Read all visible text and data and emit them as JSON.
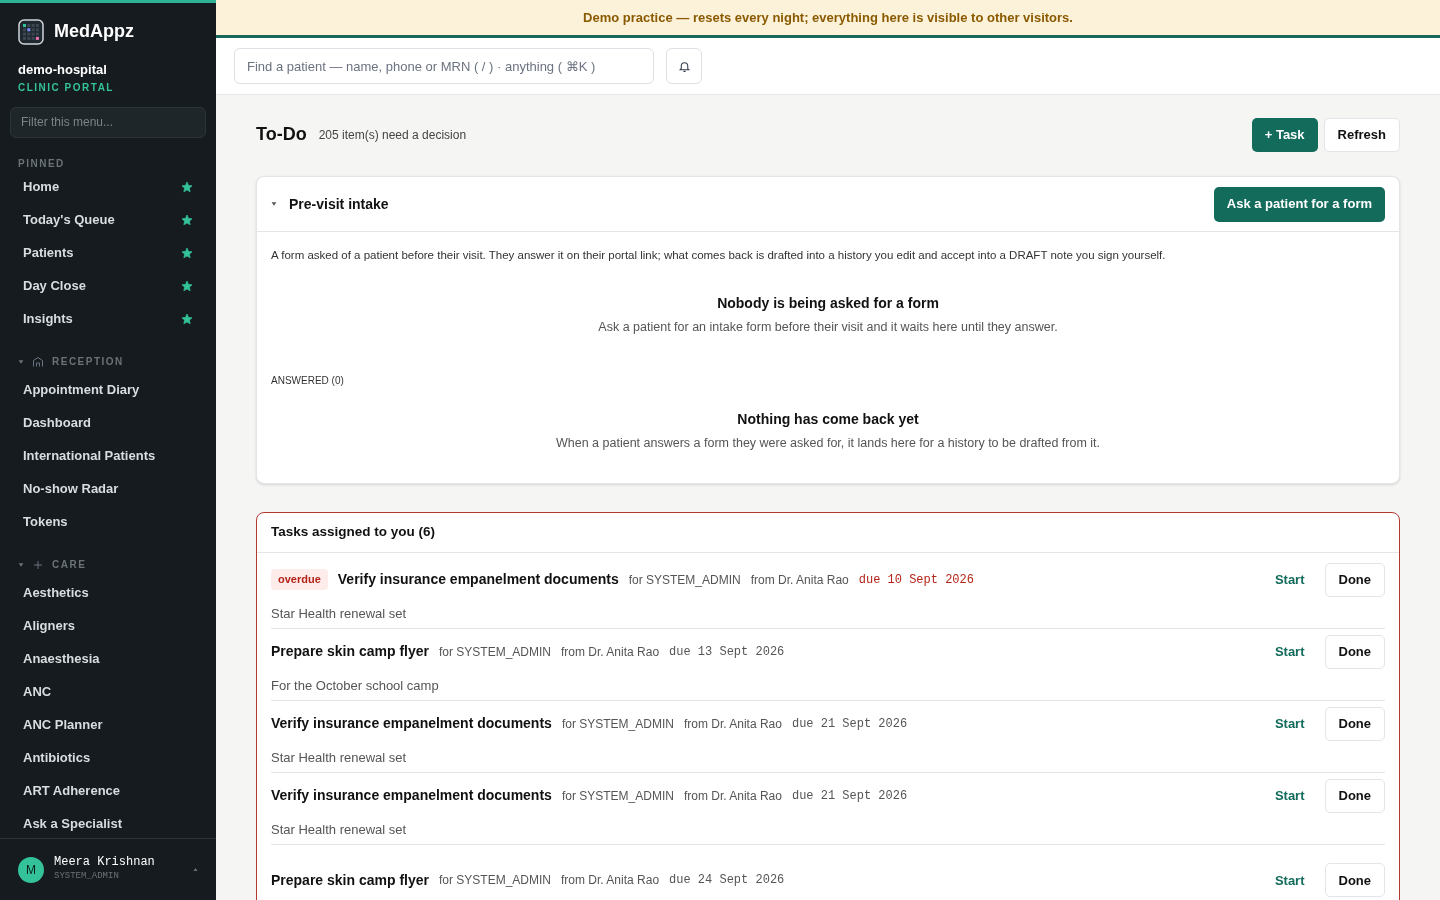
{
  "brand": {
    "name": "MedAppz",
    "org": "demo-hospital",
    "portal": "CLINIC PORTAL"
  },
  "sidebar": {
    "filter_placeholder": "Filter this menu...",
    "pinned_label": "PINNED",
    "pinned": [
      {
        "label": "Home",
        "pinned": true
      },
      {
        "label": "Today's Queue",
        "pinned": true
      },
      {
        "label": "Patients",
        "pinned": true
      },
      {
        "label": "Day Close",
        "pinned": true
      },
      {
        "label": "Insights",
        "pinned": true
      }
    ],
    "groups": [
      {
        "label": "RECEPTION",
        "kind": "reception",
        "expanded": true,
        "items": [
          "Appointment Diary",
          "Dashboard",
          "International Patients",
          "No-show Radar",
          "Tokens"
        ]
      },
      {
        "label": "CARE",
        "kind": "care",
        "expanded": true,
        "items": [
          "Aesthetics",
          "Aligners",
          "Anaesthesia",
          "ANC",
          "ANC Planner",
          "Antibiotics",
          "ART Adherence",
          "Ask a Specialist"
        ]
      }
    ],
    "user": {
      "initial": "M",
      "name": "Meera Krishnan",
      "role": "SYSTEM_ADMIN"
    }
  },
  "banner": "Demo practice — resets every night; everything here is visible to other visitors.",
  "search": {
    "placeholder": "Find a patient — name, phone or MRN ( / ) · anything ( ⌘K )"
  },
  "header": {
    "title": "To-Do",
    "subtitle": "205 item(s) need a decision",
    "buttons": [
      "+ Task",
      "Refresh"
    ]
  },
  "intake": {
    "title": "Pre-visit intake",
    "expanded": true,
    "button": "Ask a patient for a form",
    "description": "A form asked of a patient before their visit. They answer it on their portal link; what comes back is drafted into a history you edit and accept into a DRAFT note you sign yourself.",
    "empty_title": "Nobody is being asked for a form",
    "empty_text": "Ask a patient for an intake form before their visit and it waits here until they answer.",
    "answered_label": "ANSWERED (0)",
    "answered_empty_title": "Nothing has come back yet",
    "answered_empty_text": "When a patient answers a form they were asked for, it lands here for a history to be drafted from it."
  },
  "tasks": {
    "title": "Tasks assigned to you (6)",
    "items": [
      {
        "badge": "overdue",
        "overdue": true,
        "title": "Verify insurance empanelment documents",
        "for": "for SYSTEM_ADMIN",
        "from": "from Dr. Anita Rao",
        "due": "due 10 Sept 2026",
        "note": "Star Health renewal set",
        "actions": [
          "Start",
          "Done"
        ]
      },
      {
        "overdue": false,
        "title": "Prepare skin camp flyer",
        "for": "for SYSTEM_ADMIN",
        "from": "from Dr. Anita Rao",
        "due": "due 13 Sept 2026",
        "note": "For the October school camp",
        "actions": [
          "Start",
          "Done"
        ]
      },
      {
        "overdue": false,
        "title": "Verify insurance empanelment documents",
        "for": "for SYSTEM_ADMIN",
        "from": "from Dr. Anita Rao",
        "due": "due 21 Sept 2026",
        "note": "Star Health renewal set",
        "actions": [
          "Start",
          "Done"
        ]
      },
      {
        "overdue": false,
        "title": "Verify insurance empanelment documents",
        "for": "for SYSTEM_ADMIN",
        "from": "from Dr. Anita Rao",
        "due": "due 21 Sept 2026",
        "note": "Star Health renewal set",
        "actions": [
          "Start",
          "Done"
        ]
      },
      {
        "overdue": false,
        "title": "Prepare skin camp flyer",
        "for": "for SYSTEM_ADMIN",
        "from": "from Dr. Anita Rao",
        "due": "due 24 Sept 2026",
        "actions": [
          "Start",
          "Done"
        ]
      }
    ]
  }
}
